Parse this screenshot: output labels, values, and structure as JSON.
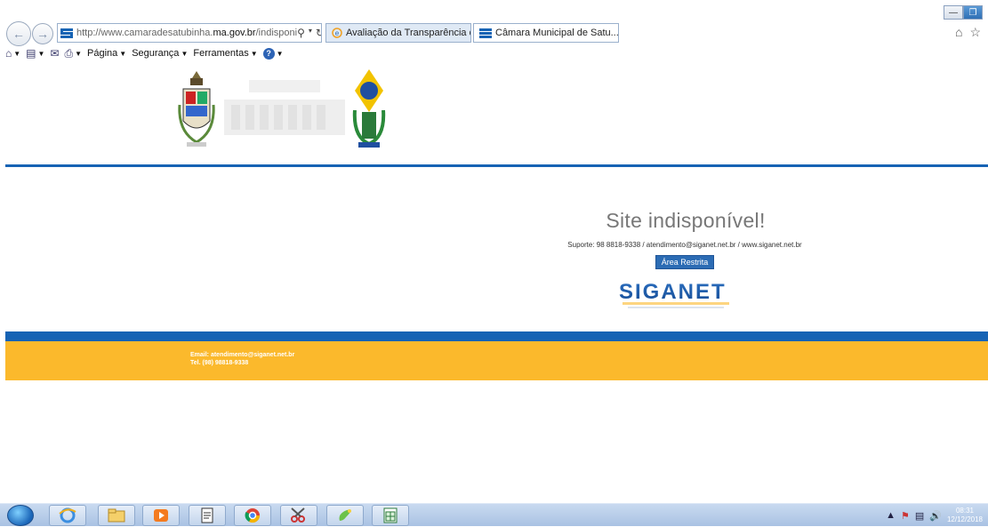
{
  "browser": {
    "url_prefix": "http://www.camaradesatubinha.",
    "url_domain": "ma.gov.br",
    "url_suffix": "/indisponi",
    "tabs": [
      {
        "label": "Avaliação da Transparência do..."
      },
      {
        "label": "Câmara Municipal de Satu..."
      }
    ],
    "command_bar": {
      "page_label": "Página",
      "security_label": "Segurança",
      "tools_label": "Ferramentas"
    }
  },
  "page": {
    "title": "Site indisponível!",
    "support": "Suporte: 98 8818-9338 / atendimento@siganet.net.br / www.siganet.net.br",
    "restricted_button": "Área Restrita",
    "brand_logo_text": "SIGANET",
    "footer": {
      "email": "Email: atendimento@siganet.net.br",
      "tel": "Tel. (98) 98818-9338"
    }
  },
  "taskbar": {
    "time": "08:31",
    "date": "12/12/2018",
    "apps": [
      "internet-explorer",
      "file-explorer",
      "media-player",
      "document-viewer",
      "chrome",
      "snipping-tool",
      "paint",
      "spreadsheet"
    ]
  },
  "colors": {
    "brand_blue": "#1663b4",
    "footer_orange": "#fbb92c",
    "button_blue": "#2c6cb4"
  }
}
